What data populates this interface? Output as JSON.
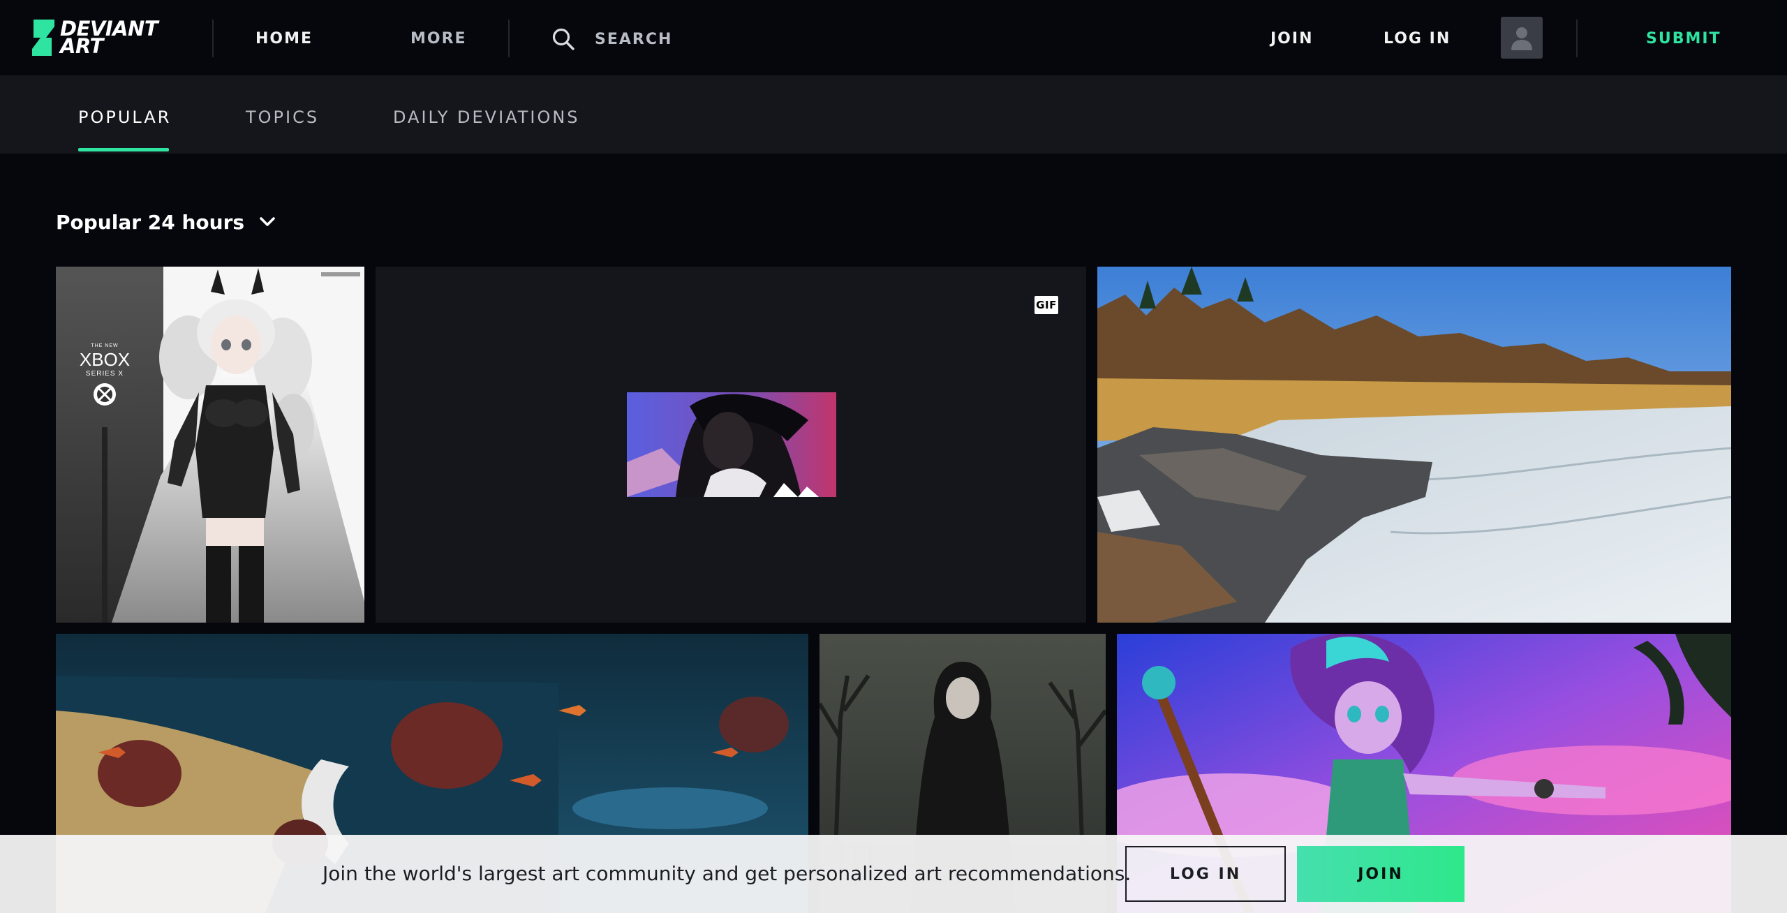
{
  "brand": {
    "line1": "Deviant",
    "line2": "Art",
    "accent": "#2fe3a0"
  },
  "nav": {
    "home": "Home",
    "more": "More",
    "search_placeholder": "Search",
    "join": "Join",
    "login": "Log In",
    "submit": "Submit"
  },
  "subnav": {
    "tabs": [
      {
        "label": "Popular",
        "active": true
      },
      {
        "label": "Topics",
        "active": false
      },
      {
        "label": "Daily Deviations",
        "active": false
      }
    ]
  },
  "filter": {
    "label": "Popular 24 hours"
  },
  "gallery": {
    "items": [
      {
        "name": "anime-xbox-girl-artwork",
        "badge": "",
        "logo_small": "THE NEW",
        "logo_main": "XBOX",
        "logo_sub": "SERIES X"
      },
      {
        "name": "animated-dark-character-gif",
        "badge": "GIF"
      },
      {
        "name": "frozen-lake-shore-photo",
        "badge": ""
      },
      {
        "name": "underwater-fish-scene-artwork",
        "badge": ""
      },
      {
        "name": "gothic-woman-cemetery-artwork",
        "badge": ""
      },
      {
        "name": "pony-girl-with-staff-artwork",
        "badge": ""
      }
    ]
  },
  "banner": {
    "text": "Join the world's largest art community and get personalized art recommendations.",
    "login": "Log In",
    "join": "Join"
  }
}
